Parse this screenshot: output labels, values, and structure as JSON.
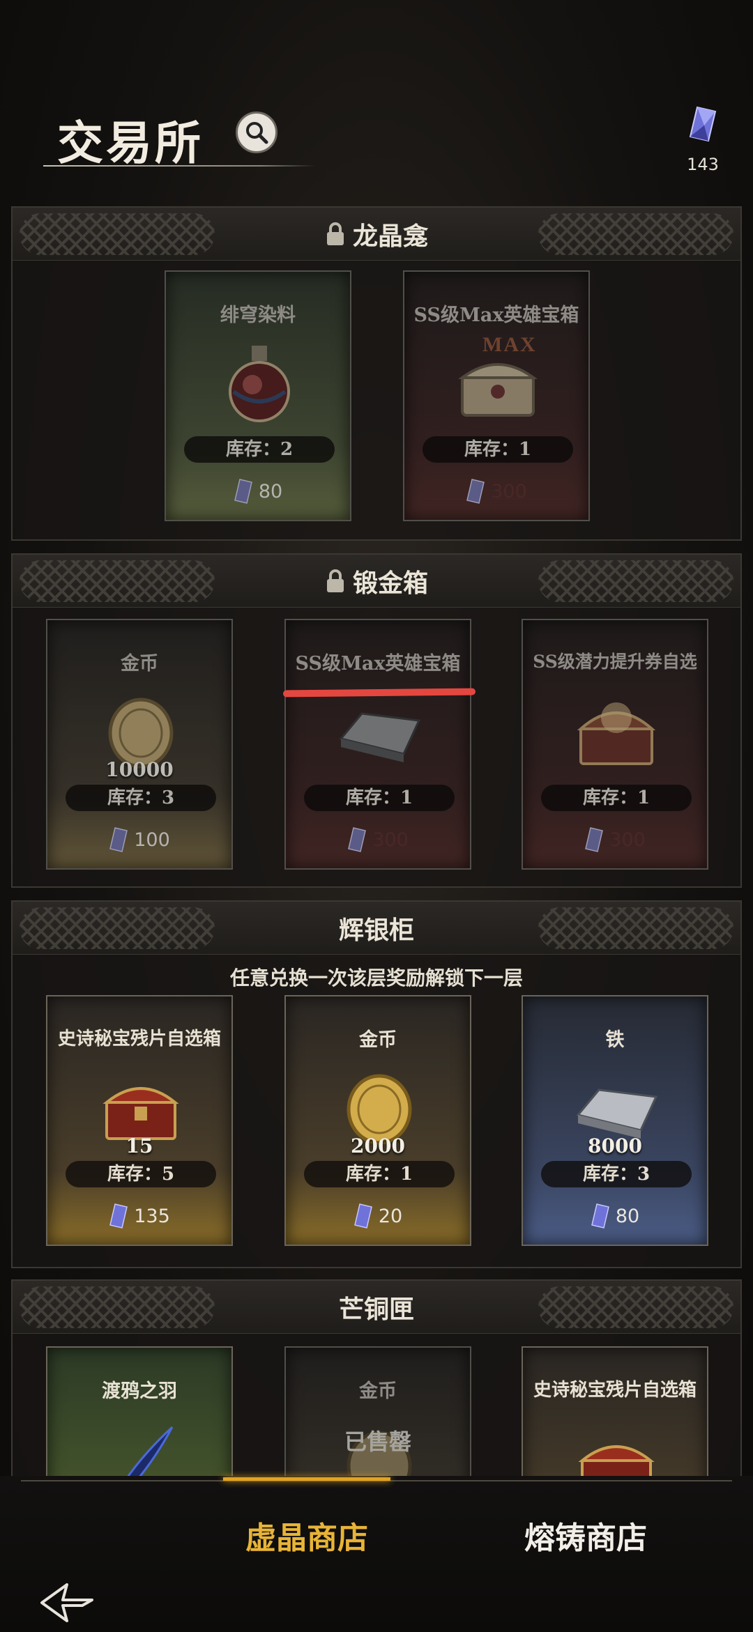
{
  "header": {
    "title": "交易所",
    "currency_amount": "143"
  },
  "panels": [
    {
      "title": "龙晶龛",
      "locked": true,
      "items": [
        {
          "name": "绯穹染料",
          "qty": "",
          "stock": "库存：2",
          "price": "80",
          "color": "green",
          "icon": "potion-icon"
        },
        {
          "name": "SS级Max英雄宝箱",
          "qty": "",
          "stock": "库存：1",
          "price": "300",
          "color": "red",
          "icon": "hero-chest-icon",
          "tag": "MAX"
        }
      ]
    },
    {
      "title": "锻金箱",
      "locked": true,
      "items": [
        {
          "name": "金币",
          "qty": "10000",
          "stock": "库存：3",
          "price": "100",
          "color": "gold",
          "icon": "gold-coin-icon"
        },
        {
          "name": "SS级Max英雄宝箱",
          "qty": "",
          "stock": "库存：1",
          "price": "300",
          "color": "red",
          "icon": "iron-ingot-icon"
        },
        {
          "name": "SS级潜力提升券自选",
          "qty": "",
          "stock": "库存：1",
          "price": "300",
          "color": "red",
          "icon": "treasure-chest-icon"
        }
      ]
    },
    {
      "title": "辉银柜",
      "subtitle": "任意兑换一次该层奖励解锁下一层",
      "locked": false,
      "items": [
        {
          "name": "史诗秘宝残片自选箱",
          "qty": "15",
          "stock": "库存：5",
          "price": "135",
          "color": "gold",
          "icon": "epic-chest-icon"
        },
        {
          "name": "金币",
          "qty": "2000",
          "stock": "库存：1",
          "price": "20",
          "color": "gold",
          "icon": "gold-coin-icon"
        },
        {
          "name": "铁",
          "qty": "8000",
          "stock": "库存：3",
          "price": "80",
          "color": "blue",
          "icon": "iron-ingot-icon"
        }
      ]
    },
    {
      "title": "芒铜匣",
      "locked": false,
      "items": [
        {
          "name": "渡鸦之羽",
          "color": "green",
          "icon": "raven-feather-icon"
        },
        {
          "name": "金币",
          "color": "gold",
          "icon": "gold-coin-icon",
          "status": "已售罄"
        },
        {
          "name": "史诗秘宝残片自选箱",
          "color": "gold",
          "icon": "epic-chest-icon"
        }
      ]
    }
  ],
  "nav": {
    "tab_active": "虚晶商店",
    "tab_other": "熔铸商店"
  },
  "colors": {
    "accent": "#e8b437",
    "annotation_underline": "#e4473f"
  }
}
